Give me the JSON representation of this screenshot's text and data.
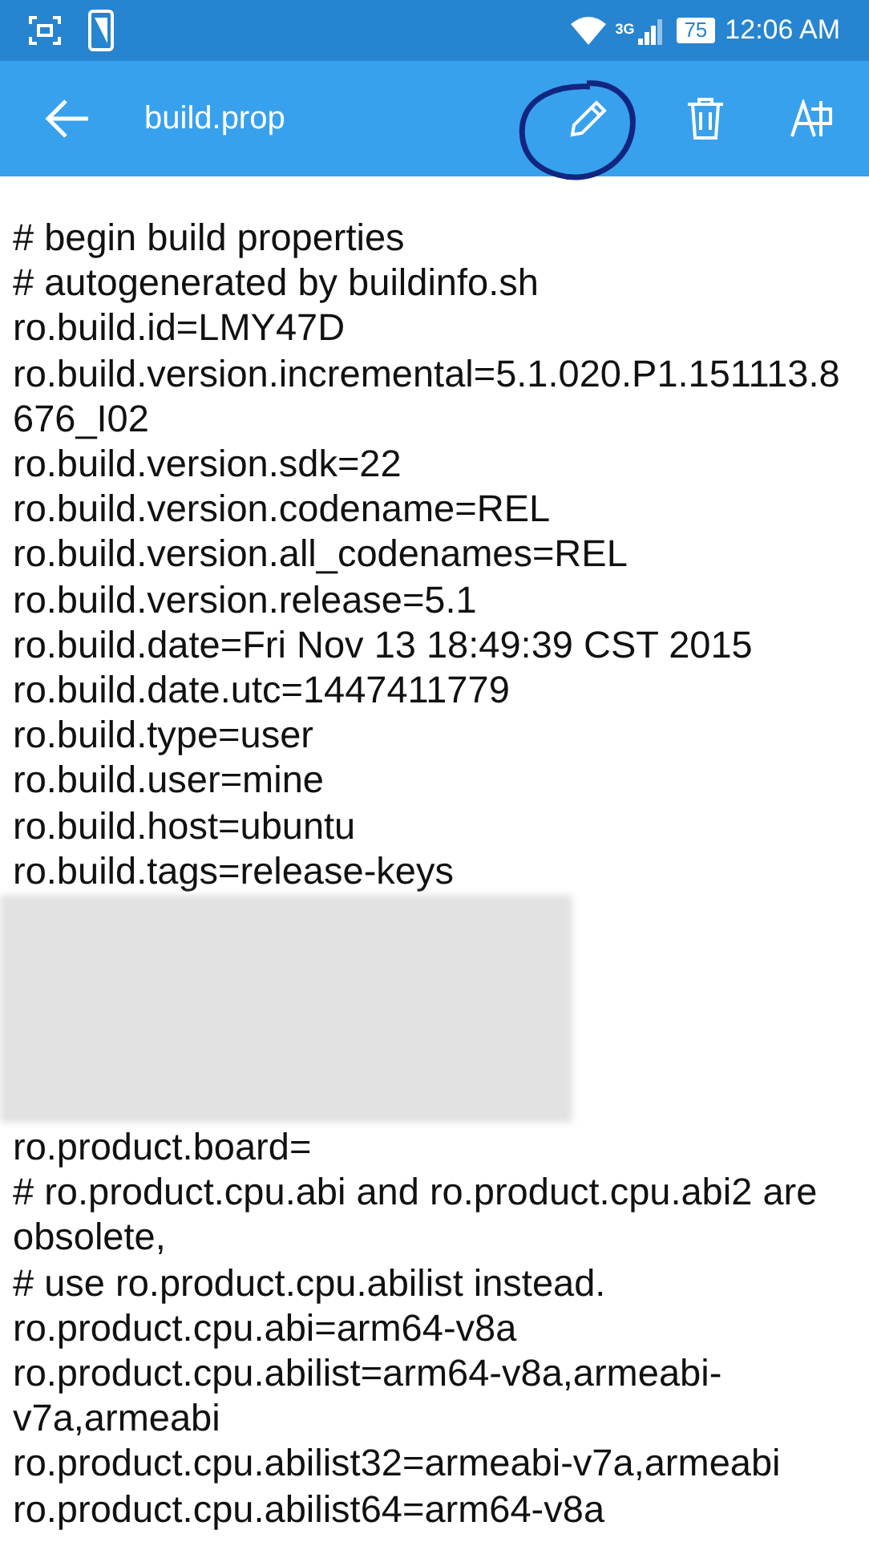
{
  "status_bar": {
    "time": "12:06 AM",
    "battery": "75",
    "network": "3G"
  },
  "toolbar": {
    "title": "build.prop"
  },
  "lines": [
    {
      "kind": "text",
      "text": "# begin build properties"
    },
    {
      "kind": "text",
      "text": "# autogenerated by buildinfo.sh"
    },
    {
      "kind": "text",
      "text": "ro.build.id=LMY47D"
    },
    {
      "kind": "text",
      "text": "ro.build.version.incremental=5.1.020.P1.151113.8676_I02"
    },
    {
      "kind": "text",
      "text": "ro.build.version.sdk=22"
    },
    {
      "kind": "text",
      "text": "ro.build.version.codename=REL"
    },
    {
      "kind": "text",
      "text": "ro.build.version.all_codenames=REL"
    },
    {
      "kind": "text",
      "text": "ro.build.version.release=5.1"
    },
    {
      "kind": "text",
      "text": "ro.build.date=Fri Nov 13 18:49:39 CST 2015"
    },
    {
      "kind": "text",
      "text": "ro.build.date.utc=1447411779"
    },
    {
      "kind": "text",
      "text": "ro.build.type=user"
    },
    {
      "kind": "text",
      "text": "ro.build.user=mine"
    },
    {
      "kind": "text",
      "text": "ro.build.host=ubuntu"
    },
    {
      "kind": "text",
      "text": "ro.build.tags=release-keys"
    },
    {
      "kind": "blurred"
    },
    {
      "kind": "text",
      "text": "ro.product.board="
    },
    {
      "kind": "text",
      "text": "# ro.product.cpu.abi and ro.product.cpu.abi2 are obsolete,"
    },
    {
      "kind": "text",
      "text": "# use ro.product.cpu.abilist instead."
    },
    {
      "kind": "text",
      "text": "ro.product.cpu.abi=arm64-v8a"
    },
    {
      "kind": "text",
      "text": "ro.product.cpu.abilist=arm64-v8a,armeabi-v7a,armeabi"
    },
    {
      "kind": "text",
      "text": "ro.product.cpu.abilist32=armeabi-v7a,armeabi"
    },
    {
      "kind": "text",
      "text": "ro.product.cpu.abilist64=arm64-v8a"
    }
  ]
}
